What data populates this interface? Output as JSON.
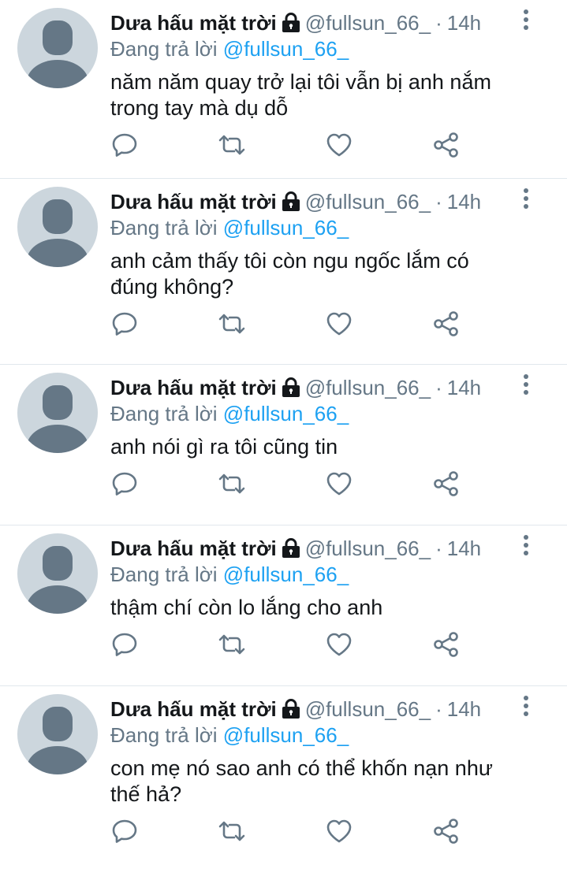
{
  "tweets": [
    {
      "name": "Dưa hấu mặt trời",
      "handle": "@fullsun_66_",
      "dot": "·",
      "time": "14h",
      "reply_prefix": "Đang trả lời",
      "reply_to": "@fullsun_66_",
      "text": "năm năm quay trở lại tôi vẫn bị anh nắm\ntrong tay mà dụ dỗ"
    },
    {
      "name": "Dưa hấu mặt trời",
      "handle": "@fullsun_66_",
      "dot": "·",
      "time": "14h",
      "reply_prefix": "Đang trả lời",
      "reply_to": "@fullsun_66_",
      "text": "anh cảm thấy tôi còn ngu ngốc lắm có\nđúng không?"
    },
    {
      "name": "Dưa hấu mặt trời",
      "handle": "@fullsun_66_",
      "dot": "·",
      "time": "14h",
      "reply_prefix": "Đang trả lời",
      "reply_to": "@fullsun_66_",
      "text": "anh nói gì ra tôi cũng tin"
    },
    {
      "name": "Dưa hấu mặt trời",
      "handle": "@fullsun_66_",
      "dot": "·",
      "time": "14h",
      "reply_prefix": "Đang trả lời",
      "reply_to": "@fullsun_66_",
      "text": "thậm chí còn lo lắng cho anh"
    },
    {
      "name": "Dưa hấu mặt trời",
      "handle": "@fullsun_66_",
      "dot": "·",
      "time": "14h",
      "reply_prefix": "Đang trả lời",
      "reply_to": "@fullsun_66_",
      "text": "con mẹ nó sao anh có thể khốn nạn như\nthế hả?"
    }
  ],
  "icons": {
    "reply": "reply-icon",
    "retweet": "retweet-icon",
    "like": "heart-icon",
    "share": "share-icon",
    "more": "more-vertical-icon",
    "lock": "lock-icon"
  },
  "colors": {
    "name": "#14171a",
    "secondary": "#657786",
    "mention": "#1da1f2",
    "avatar_bg": "#ccd6dd",
    "divider": "#e1e8ed"
  }
}
